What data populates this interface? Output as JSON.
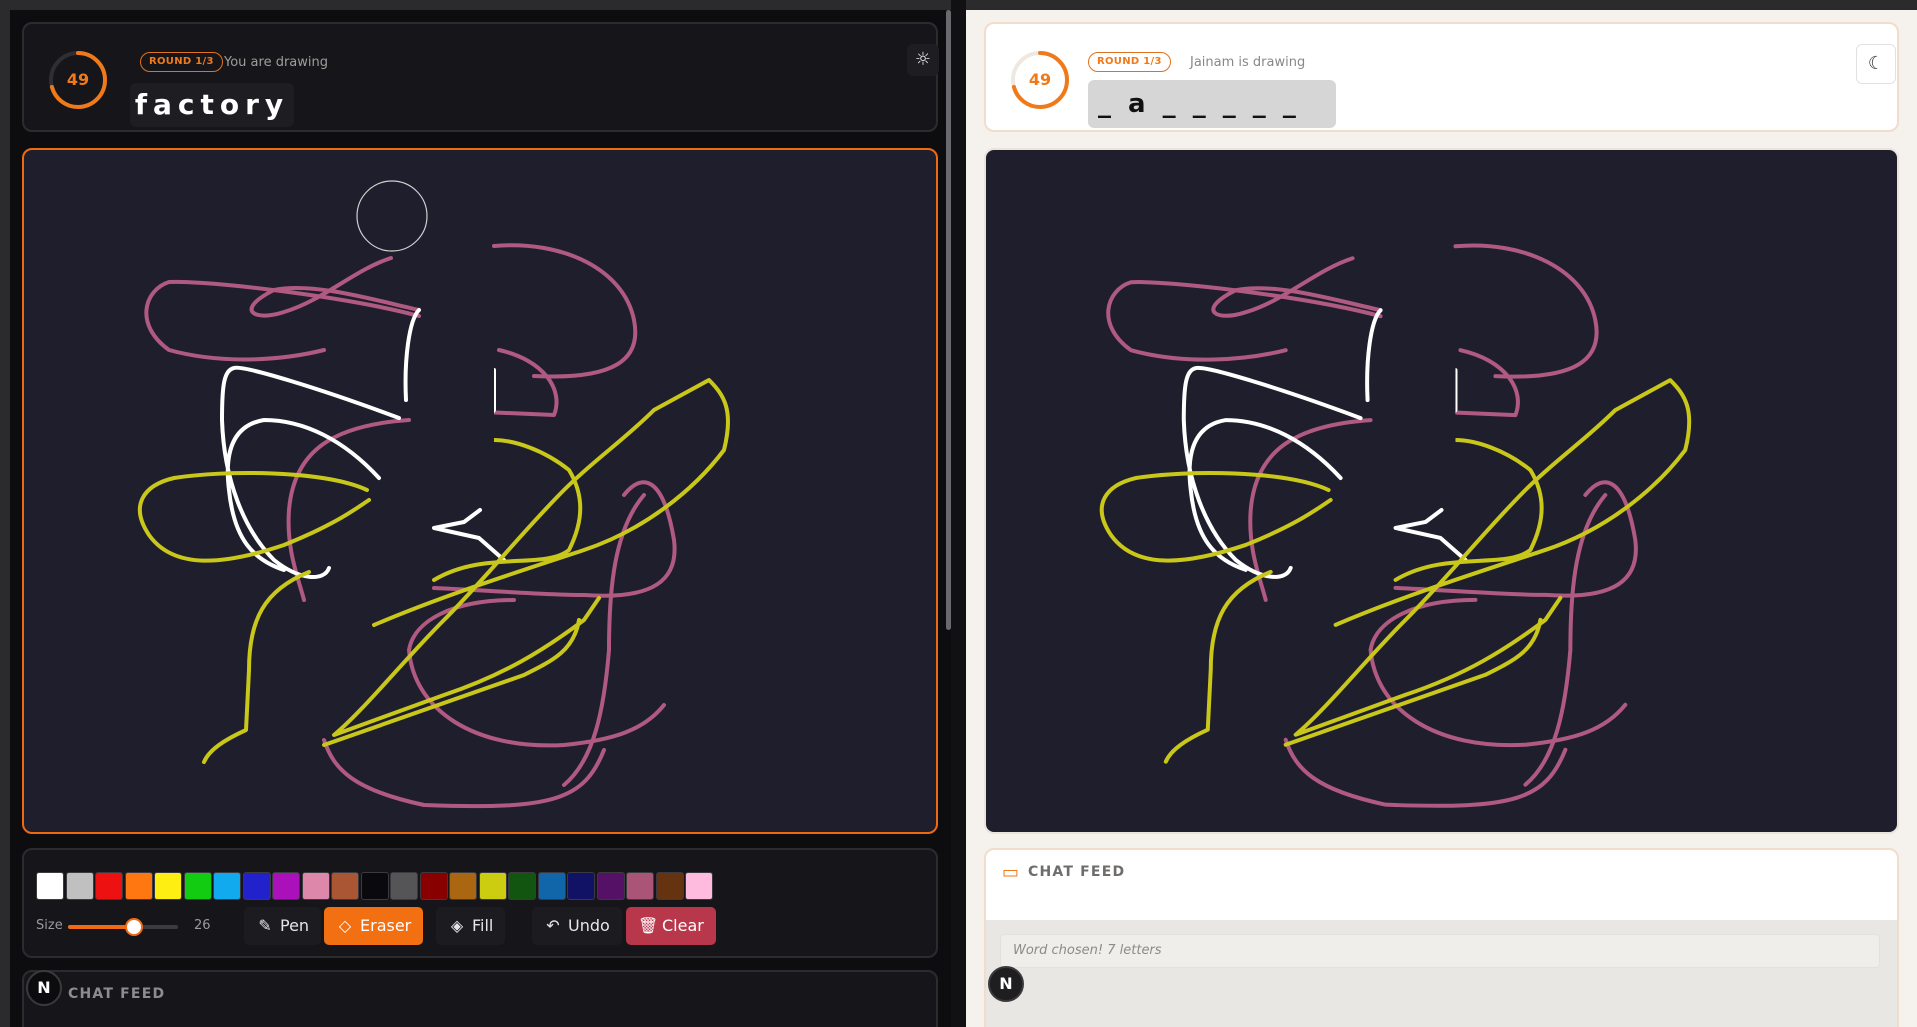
{
  "drawer": {
    "timer": "49",
    "round": "ROUND 1/3",
    "status": "You are drawing",
    "word": "factory",
    "theme_icon": "sun-icon",
    "palette": [
      "#ffffff",
      "#c0c0c0",
      "#ee1111",
      "#ff7711",
      "#ffee11",
      "#11cc11",
      "#11aaee",
      "#2222cc",
      "#aa11bb",
      "#dd88aa",
      "#aa5533",
      "#0a0a0e",
      "#555558",
      "#880000",
      "#aa6611",
      "#cccc11",
      "#115511",
      "#1166aa",
      "#111166",
      "#551166",
      "#aa5577",
      "#663311",
      "#ffbbdd"
    ],
    "size_label": "Size",
    "size_value": "26",
    "size_fraction": 0.6,
    "tools": {
      "pen": "Pen",
      "eraser": "Eraser",
      "fill": "Fill",
      "undo": "Undo",
      "clear": "Clear"
    },
    "chat_title": "CHAT FEED",
    "badge": "N"
  },
  "guesser": {
    "timer": "49",
    "round": "ROUND 1/3",
    "status": "Jainam is drawing",
    "hint": "_ a _ _ _ _ _",
    "theme_icon": "moon-icon",
    "chat_title": "CHAT FEED",
    "chat_message": "Word chosen! 7 letters",
    "badge": "N"
  },
  "colors": {
    "accent": "#f26f12",
    "canvas_bg": "#1f1e2d",
    "stroke_pink": "#b05a82",
    "stroke_yellow": "#c9c81a",
    "stroke_white": "#ffffff"
  }
}
